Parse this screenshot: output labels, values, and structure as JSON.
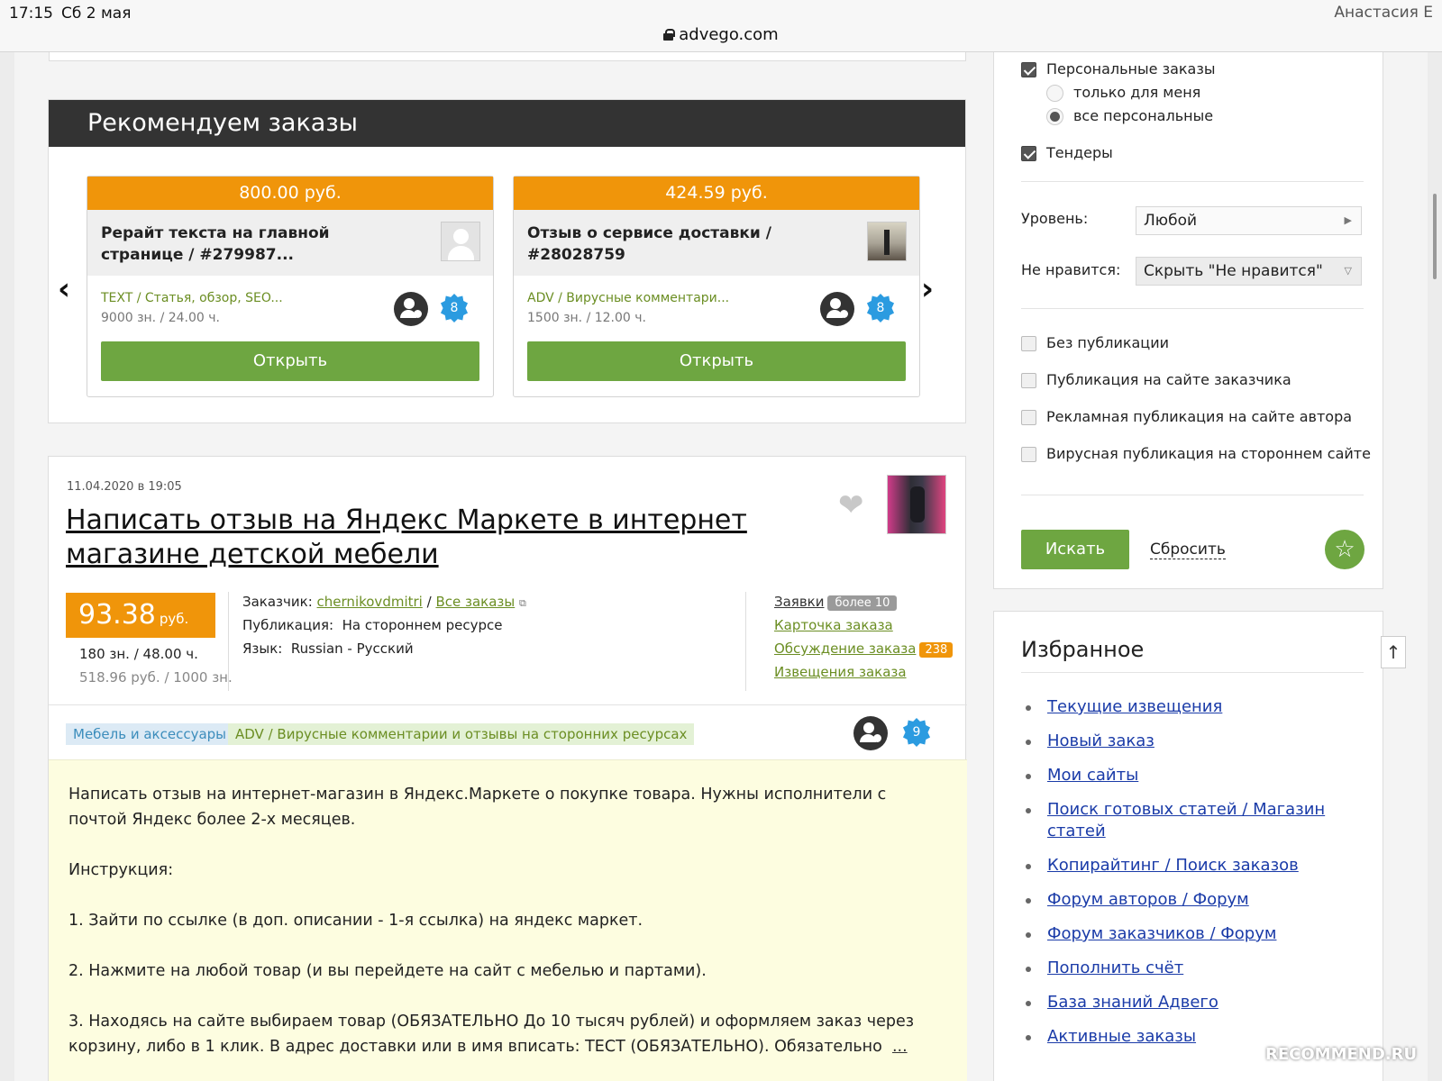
{
  "status": {
    "time": "17:15",
    "date": "Сб 2 мая",
    "user": "Анастасия Е"
  },
  "browser": {
    "url": "advego.com"
  },
  "recommend": {
    "title": "Рекомендуем заказы",
    "cards": [
      {
        "price": "800.00 руб.",
        "title": "Рерайт текста на главной странице / #279987...",
        "category": "TEXT / Статья, обзор, SEO...",
        "meta": "9000 зн.  / 24.00 ч.",
        "badge": "8",
        "button": "Открыть",
        "thumb": "user-placeholder"
      },
      {
        "price": "424.59 руб.",
        "title": "Отзыв о сервисе доставки / #28028759",
        "category": "ADV / Вирусные комментари...",
        "meta": "1500 зн.  / 12.00 ч.",
        "badge": "8",
        "button": "Открыть",
        "thumb": "photo"
      }
    ],
    "prev_icon": "chevron-left-icon",
    "next_icon": "chevron-right-icon"
  },
  "order": {
    "date": "11.04.2020 в 19:05",
    "title": "Написать отзыв на Яндекс Маркете в интернет магазине детской мебели",
    "price": "93.38",
    "currency": "руб.",
    "volume": "180 зн.  / 48.00 ч.",
    "rate": "518.96 руб.  / 1000 зн.",
    "customer_label": "Заказчик:",
    "customer": "chernikovdmitri",
    "all_orders": "Все заказы",
    "publication_label": "Публикация:",
    "publication": "На стороннем ресурсе",
    "language_label": "Язык:",
    "language": "Russian - Русский",
    "links": {
      "applications": "Заявки",
      "applications_count": "более 10",
      "card": "Карточка заказа",
      "discussion": "Обсуждение заказа",
      "discussion_count": "238",
      "notifications": "Извещения заказа"
    },
    "tag_category": "Мебель и аксессуары",
    "tag_type": "ADV / Вирусные комментарии и отзывы на сторонних ресурсах",
    "badge": "9",
    "description": [
      "Написать отзыв на интернет-магазин в Яндекс.Маркете о покупке товара. Нужны исполнители с почтой Яндекс более 2-х месяцев.",
      "Инструкция:",
      "1. Зайти по ссылке (в доп. описании - 1-я ссылка) на яндекс маркет.",
      "2. Нажмите на любой товар (и вы перейдете на сайт с мебелью и партами).",
      "3. Находясь на сайте выбираем товар (ОБЯЗАТЕЛЬНО До 10 тысяч рублей) и оформляем заказ через корзину, либо в 1 клик. В адрес доставки или в имя вписать: ТЕСТ (ОБЯЗАТЕЛЬНО). Обязательно"
    ],
    "more": "..."
  },
  "filters": {
    "personal": "Персональные заказы",
    "only_me": "только для меня",
    "all_personal": "все персональные",
    "tenders": "Тендеры",
    "level_label": "Уровень:",
    "level_value": "Любой",
    "dislike_label": "Не нравится:",
    "dislike_value": "Скрыть \"Не нравится\"",
    "no_pub": "Без публикации",
    "pub_customer": "Публикация на сайте заказчика",
    "pub_ad": "Рекламная публикация на сайте автора",
    "pub_viral": "Вирусная публикация на стороннем сайте",
    "search_btn": "Искать",
    "reset": "Сбросить"
  },
  "favorites": {
    "title": "Избранное",
    "items": [
      "Текущие извещения",
      "Новый заказ",
      "Мои сайты",
      "Поиск готовых статей / Магазин статей",
      "Копирайтинг / Поиск заказов",
      "Форум авторов / Форум",
      "Форум заказчиков / Форум",
      "Пополнить счёт",
      "База знаний Адвего",
      "Активные заказы"
    ]
  },
  "colors": {
    "accent_orange": "#f0950a",
    "button_green": "#6ea641",
    "link_green": "#6b8e23",
    "link_blue": "#1a3ba8"
  },
  "watermark": "RECOMMEND.RU"
}
